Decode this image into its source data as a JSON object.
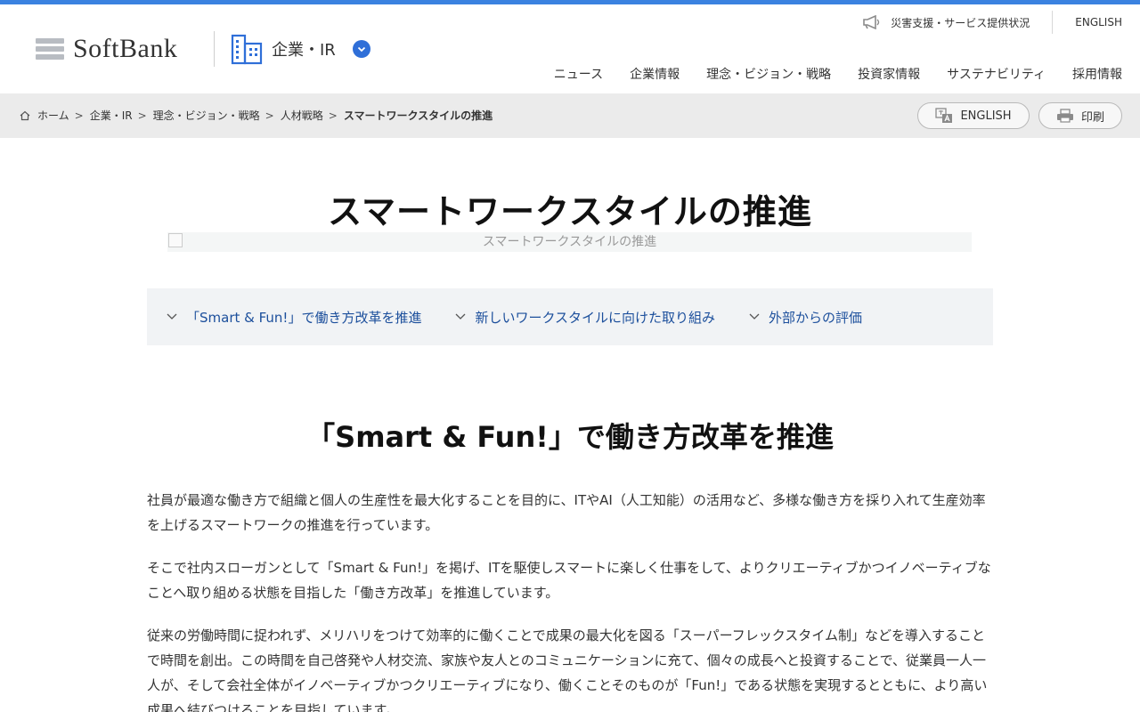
{
  "header": {
    "brand": "SoftBank",
    "section_label": "企業・IR",
    "util_disaster": "災害支援・サービス提供状況",
    "util_english": "ENGLISH",
    "nav": [
      "ニュース",
      "企業情報",
      "理念・ビジョン・戦略",
      "投資家情報",
      "サステナビリティ",
      "採用情報"
    ]
  },
  "breadcrumb": {
    "items": [
      "ホーム",
      "企業・IR",
      "理念・ビジョン・戦略",
      "人材戦略"
    ],
    "current": "スマートワークスタイルの推進",
    "separator": ">"
  },
  "tools": {
    "english_label": "ENGLISH",
    "print_label": "印刷"
  },
  "main": {
    "title": "スマートワークスタイルの推進",
    "hero_alt": "スマートワークスタイルの推進",
    "anchors": [
      "「Smart & Fun!」で働き方改革を推進",
      "新しいワークスタイルに向けた取り組み",
      "外部からの評価"
    ],
    "section_title": "「Smart & Fun!」で働き方改革を推進",
    "paragraphs": [
      "社員が最適な働き方で組織と個人の生産性を最大化することを目的に、ITやAI（人工知能）の活用など、多様な働き方を採り入れて生産効率を上げるスマートワークの推進を行っています。",
      "そこで社内スローガンとして「Smart & Fun!」を掲げ、ITを駆使しスマートに楽しく仕事をして、よりクリエーティブかつイノベーティブなことへ取り組める状態を目指した「働き方改革」を推進しています。",
      "従来の労働時間に捉われず、メリハリをつけて効率的に働くことで成果の最大化を図る「スーパーフレックスタイム制」などを導入することで時間を創出。この時間を自己啓発や人材交流、家族や友人とのコミュニケーションに充て、個々の成長へと投資することで、従業員一人一人が、そして会社全体がイノベーティブかつクリエーティブになり、働くことそのものが「Fun!」である状態を実現するとともに、より高い成果へ結びつけることを目指しています。"
    ]
  },
  "colors": {
    "accent": "#3b82e0",
    "link": "#1c4f9c",
    "band": "#ebebeb",
    "anchor_bg": "#f1f3f5"
  }
}
